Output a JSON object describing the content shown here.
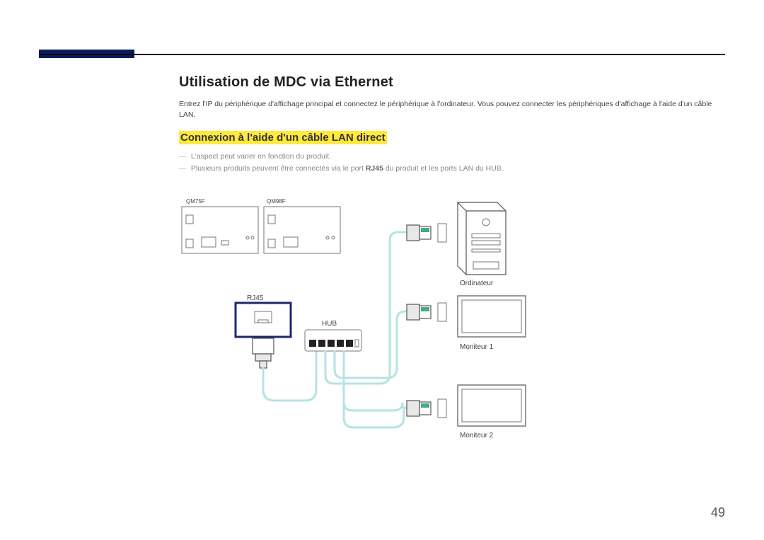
{
  "heading": "Utilisation de MDC via Ethernet",
  "intro": "Entrez l'IP du périphérique d'affichage principal et connectez le périphérique à l'ordinateur. Vous pouvez connecter les périphériques d'affichage à l'aide d'un câble LAN.",
  "subheading": "Connexion à l'aide d'un câble LAN direct",
  "notes": [
    "L'aspect peut varier en fonction du produit.",
    "Plusieurs produits peuvent être connectés via le port RJ45 du produit et les ports LAN du HUB."
  ],
  "notes_bold_token": "RJ45",
  "diagram": {
    "model_a": "QM75F",
    "model_b": "QM98F",
    "rj45_label": "RJ45",
    "hub_label": "HUB",
    "computer_label": "Ordinateur",
    "monitor1_label": "Moniteur 1",
    "monitor2_label": "Moniteur 2"
  },
  "page_number": "49"
}
